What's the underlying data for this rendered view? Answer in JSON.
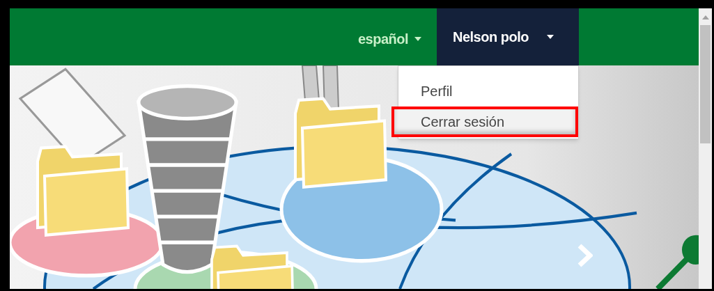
{
  "navbar": {
    "language": {
      "label": "español"
    },
    "user": {
      "label": "Nelson polo",
      "expanded": true
    }
  },
  "user_menu": [
    {
      "label": "Perfil",
      "highlighted": false
    },
    {
      "label": "Cerrar sesión",
      "highlighted": true
    }
  ]
}
